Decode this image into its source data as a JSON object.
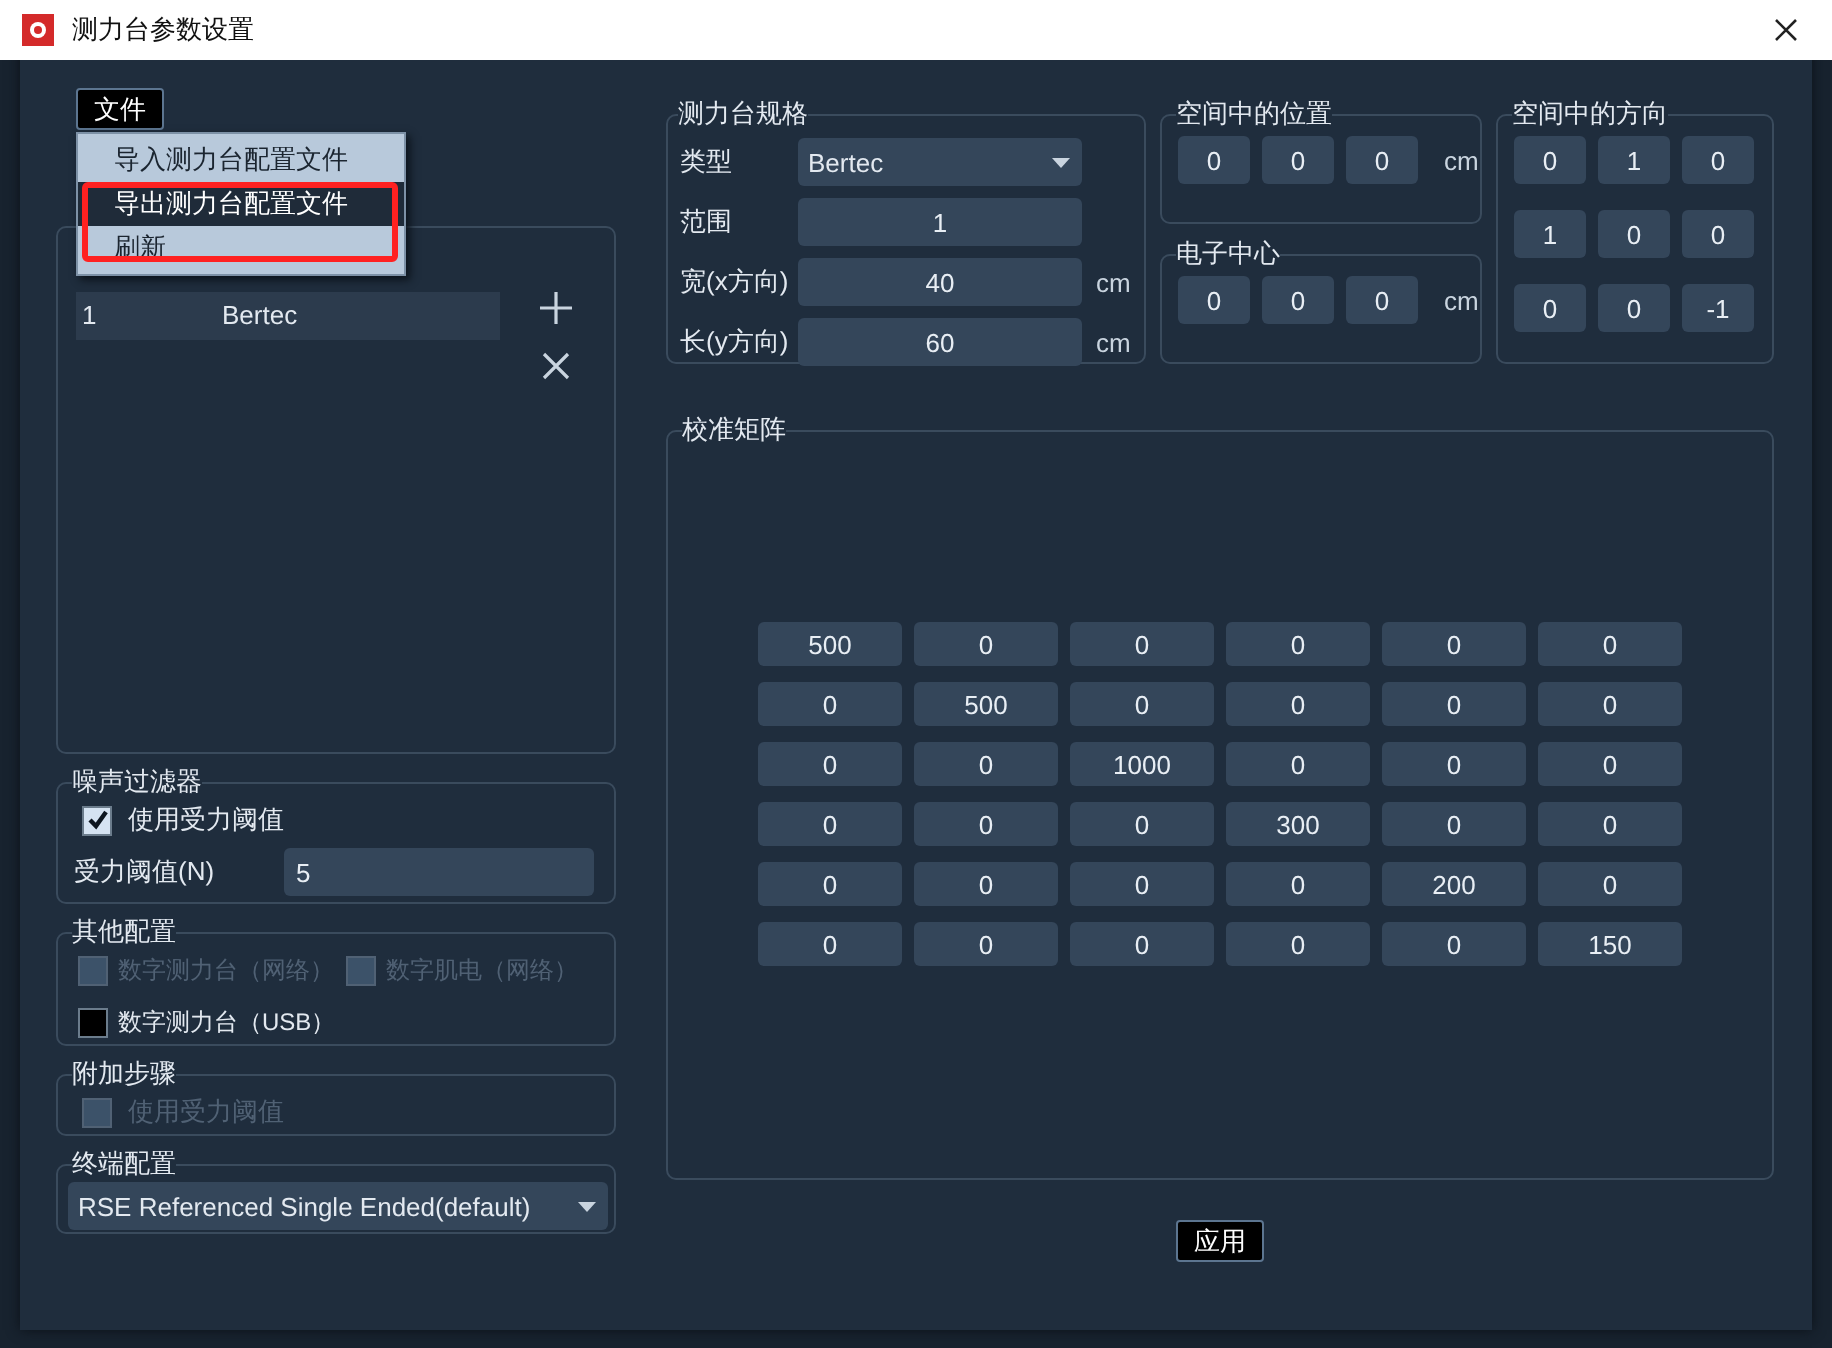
{
  "window": {
    "title": "测力台参数设置"
  },
  "file_menu": {
    "label": "文件",
    "items": [
      {
        "label": "导入测力台配置文件",
        "selected": false
      },
      {
        "label": "导出测力台配置文件",
        "selected": true
      },
      {
        "label": "刷新",
        "selected": false
      }
    ]
  },
  "platform_list": {
    "rows": [
      {
        "index": "1",
        "type": "Bertec",
        "selected": true
      }
    ]
  },
  "noise_filter": {
    "title": "噪声过滤器",
    "checkbox": {
      "label": "使用受力阈值",
      "checked": true,
      "disabled": false
    },
    "threshold_label": "受力阈值(N)",
    "threshold_value": "5"
  },
  "other_config": {
    "title": "其他配置",
    "options": [
      {
        "label": "数字测力台（网络）",
        "checked": false,
        "disabled": true
      },
      {
        "label": "数字肌电（网络）",
        "checked": false,
        "disabled": true
      },
      {
        "label": "数字测力台（USB）",
        "checked": false,
        "disabled": false
      }
    ]
  },
  "extra_steps": {
    "title": "附加步骤",
    "options": [
      {
        "label": "使用受力阈值",
        "checked": false,
        "disabled": true
      }
    ]
  },
  "terminal_config": {
    "title": "终端配置",
    "value": "RSE Referenced Single Ended(default)"
  },
  "spec": {
    "title": "测力台规格",
    "fields": [
      {
        "label": "类型",
        "kind": "dropdown",
        "value": "Bertec"
      },
      {
        "label": "范围",
        "kind": "input",
        "value": "1"
      },
      {
        "label": "宽(x方向)",
        "kind": "input",
        "value": "40",
        "unit": "cm"
      },
      {
        "label": "长(y方向)",
        "kind": "input",
        "value": "60",
        "unit": "cm"
      }
    ]
  },
  "position": {
    "title": "空间中的位置",
    "values": [
      "0",
      "0",
      "0"
    ],
    "unit": "cm"
  },
  "electric_center": {
    "title": "电子中心",
    "values": [
      "0",
      "0",
      "0"
    ],
    "unit": "cm"
  },
  "orientation": {
    "title": "空间中的方向",
    "rows": [
      [
        "0",
        "1",
        "0"
      ],
      [
        "1",
        "0",
        "0"
      ],
      [
        "0",
        "0",
        "-1"
      ]
    ]
  },
  "calibration": {
    "title": "校准矩阵",
    "rows": [
      [
        "500",
        "0",
        "0",
        "0",
        "0",
        "0"
      ],
      [
        "0",
        "500",
        "0",
        "0",
        "0",
        "0"
      ],
      [
        "0",
        "0",
        "1000",
        "0",
        "0",
        "0"
      ],
      [
        "0",
        "0",
        "0",
        "300",
        "0",
        "0"
      ],
      [
        "0",
        "0",
        "0",
        "0",
        "200",
        "0"
      ],
      [
        "0",
        "0",
        "0",
        "0",
        "0",
        "150"
      ]
    ]
  },
  "apply_button": "应用"
}
